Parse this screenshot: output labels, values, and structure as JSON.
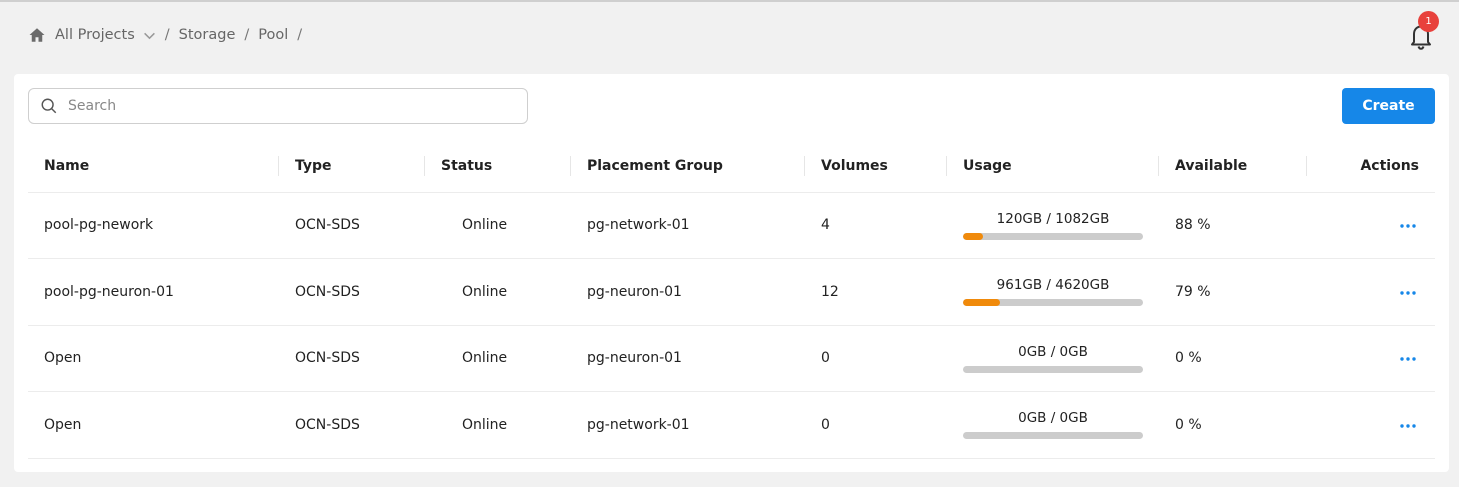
{
  "breadcrumb": {
    "projects": "All Projects",
    "sep1": "/",
    "storage": "Storage",
    "sep2": "/",
    "pool": "Pool",
    "sep3": "/"
  },
  "notifications": {
    "count": "1"
  },
  "search": {
    "placeholder": "Search",
    "value": ""
  },
  "toolbar": {
    "create_label": "Create"
  },
  "table": {
    "headers": {
      "name": "Name",
      "type": "Type",
      "status": "Status",
      "placement": "Placement Group",
      "volumes": "Volumes",
      "usage": "Usage",
      "available": "Available",
      "actions": "Actions"
    },
    "rows": [
      {
        "name": "pool-pg-nework",
        "type": "OCN-SDS",
        "status": "Online",
        "placement": "pg-network-01",
        "volumes": "4",
        "usage": "120GB / 1082GB",
        "usage_fraction": 0.111,
        "available": "88 %"
      },
      {
        "name": "pool-pg-neuron-01",
        "type": "OCN-SDS",
        "status": "Online",
        "placement": "pg-neuron-01",
        "volumes": "12",
        "usage": "961GB / 4620GB",
        "usage_fraction": 0.208,
        "available": "79 %"
      },
      {
        "name": "Open",
        "type": "OCN-SDS",
        "status": "Online",
        "placement": "pg-neuron-01",
        "volumes": "0",
        "usage": "0GB / 0GB",
        "usage_fraction": 0,
        "available": "0 %"
      },
      {
        "name": "Open",
        "type": "OCN-SDS",
        "status": "Online",
        "placement": "pg-network-01",
        "volumes": "0",
        "usage": "0GB / 0GB",
        "usage_fraction": 0,
        "available": "0 %"
      }
    ]
  },
  "colors": {
    "accent": "#1687e8",
    "usage_fill": "#f08a0b",
    "usage_track": "#cccccc",
    "badge": "#e8413c"
  },
  "icons": {
    "home": "home-icon",
    "dropdown": "chevron-down-icon",
    "bell": "bell-icon",
    "search": "search-icon",
    "actions": "more-horizontal-icon"
  }
}
